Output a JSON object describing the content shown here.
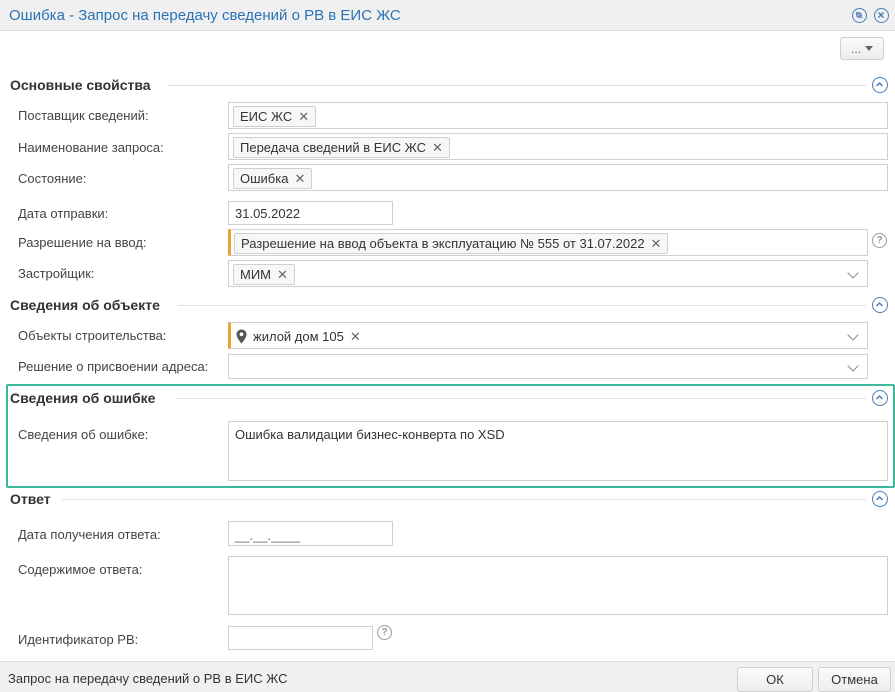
{
  "window": {
    "title": "Ошибка - Запрос на передачу сведений о РВ в ЕИС ЖС"
  },
  "toolbar": {
    "more_label": "..."
  },
  "sections": {
    "main": {
      "title": "Основные свойства",
      "supplier": {
        "label": "Поставщик сведений:",
        "value": "ЕИС ЖС"
      },
      "request_name": {
        "label": "Наименование запроса:",
        "value": "Передача сведений в ЕИС ЖС"
      },
      "state": {
        "label": "Состояние:",
        "value": "Ошибка"
      },
      "send_date": {
        "label": "Дата отправки:",
        "value": "31.05.2022"
      },
      "permit": {
        "label": "Разрешение на ввод:",
        "value": "Разрешение на ввод объекта в эксплуатацию № 555 от 31.07.2022"
      },
      "developer": {
        "label": "Застройщик:",
        "value": "МИМ"
      }
    },
    "object": {
      "title": "Сведения об объекте",
      "construction_objects": {
        "label": "Объекты строительства:",
        "value": "жилой дом 105"
      },
      "address_decision": {
        "label": "Решение о присвоении адреса:",
        "value": ""
      }
    },
    "error": {
      "title": "Сведения об ошибке",
      "details": {
        "label": "Сведения об ошибке:",
        "value": "Ошибка валидации бизнес-конверта по XSD"
      }
    },
    "response": {
      "title": "Ответ",
      "received_date": {
        "label": "Дата получения ответа:",
        "placeholder": "__.__.____"
      },
      "content": {
        "label": "Содержимое ответа:",
        "value": ""
      },
      "rv_id": {
        "label": "Идентификатор РВ:",
        "value": ""
      }
    }
  },
  "status": {
    "text": "Запрос на передачу сведений о РВ в ЕИС ЖС"
  },
  "buttons": {
    "ok": "ОК",
    "cancel": "Отмена"
  },
  "colors": {
    "title": "#2a74b5",
    "icon": "#4a7fb8",
    "required": "#e8a33a",
    "highlight": "#3bb89a"
  },
  "icons": [
    "settings-circle-icon",
    "close-circle-icon",
    "collapse-up-icon",
    "help-icon",
    "map-pin-icon",
    "remove-tag-icon",
    "chevron-down-icon"
  ]
}
